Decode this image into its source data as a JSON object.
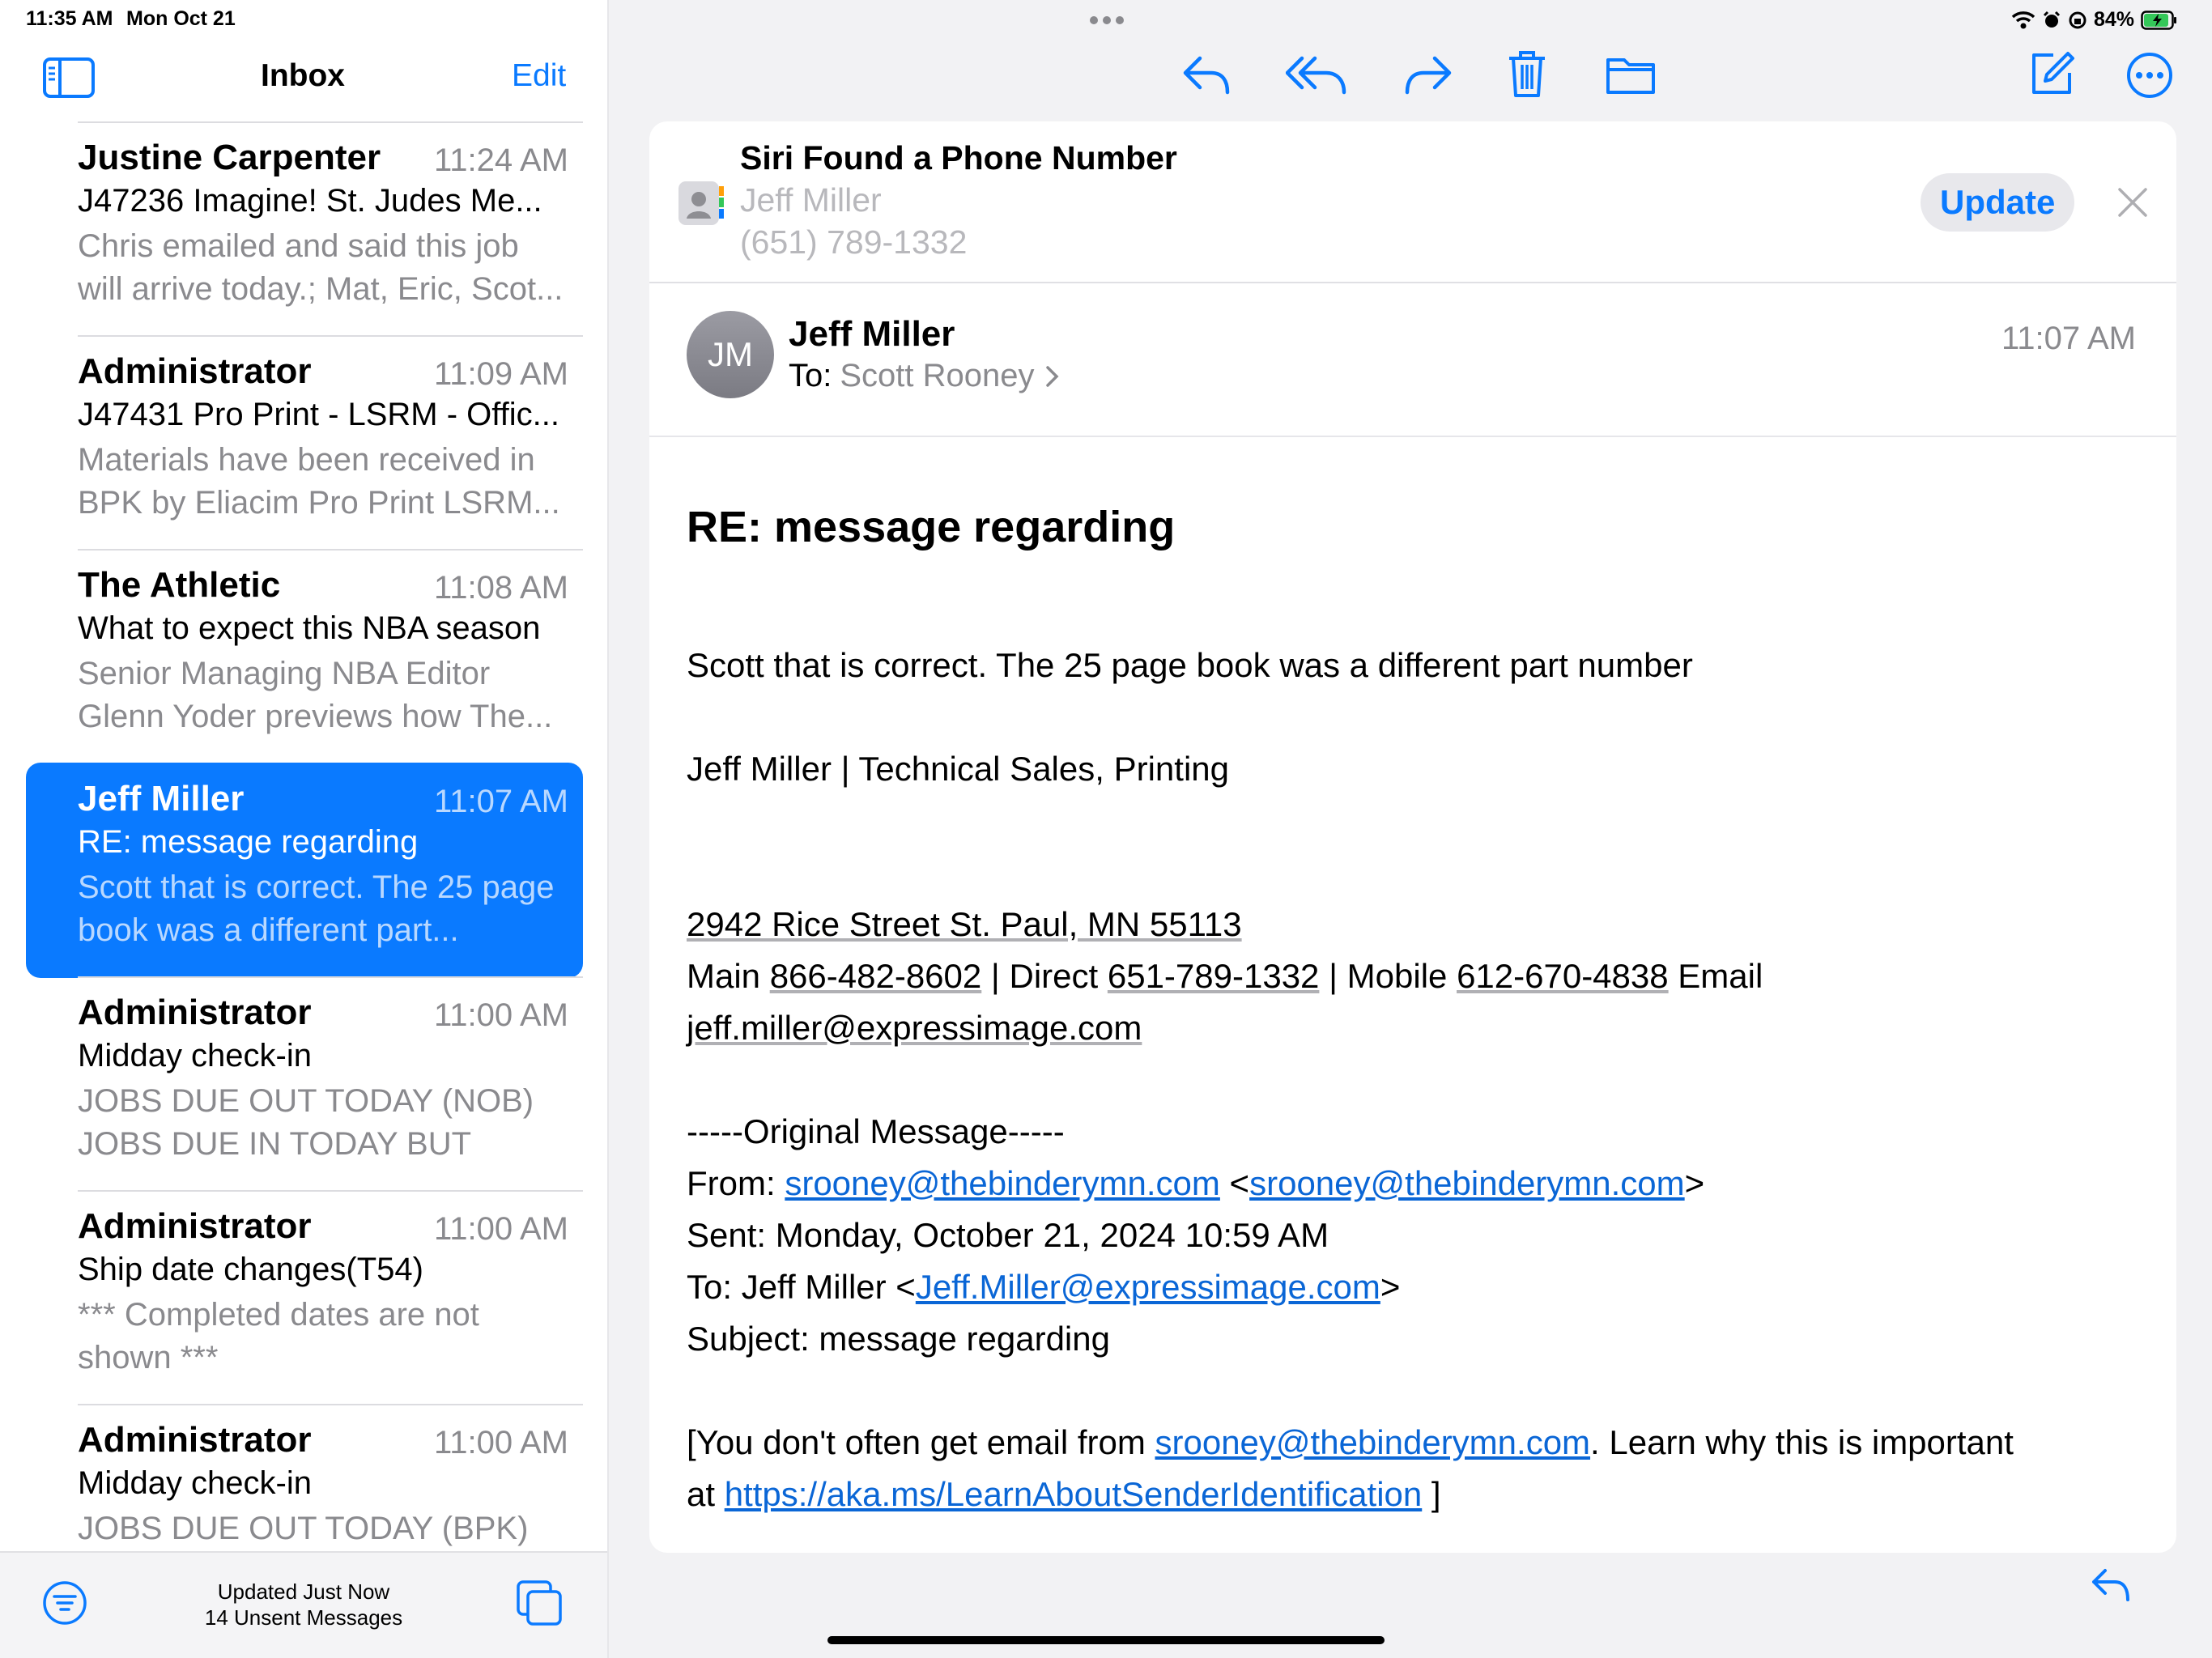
{
  "status": {
    "time": "11:35 AM",
    "date": "Mon Oct 21",
    "battery": "84%"
  },
  "sidebar": {
    "title": "Inbox",
    "edit": "Edit"
  },
  "messages": [
    {
      "sender": "Justine Carpenter",
      "time": "11:24 AM",
      "subject": "J47236 Imagine! St. Judes Me...",
      "preview": "Chris emailed and said this job will arrive today.; Mat, Eric, Scot..."
    },
    {
      "sender": "Administrator",
      "time": "11:09 AM",
      "subject": "J47431 Pro Print - LSRM - Offic...",
      "preview": "Materials have been received in BPK by Eliacim Pro Print LSRM..."
    },
    {
      "sender": "The Athletic",
      "time": "11:08 AM",
      "subject": "What to expect this NBA season",
      "preview": "Senior Managing NBA Editor Glenn Yoder previews how The..."
    },
    {
      "sender": "Jeff Miller",
      "time": "11:07 AM",
      "subject": "RE: message regarding",
      "preview": "Scott that is correct. The 25 page book was a different part...",
      "selected": true
    },
    {
      "sender": "Administrator",
      "time": "11:00 AM",
      "subject": "Midday check-in",
      "preview": "JOBS DUE OUT TODAY (NOB) JOBS DUE IN TODAY BUT NOT..."
    },
    {
      "sender": "Administrator",
      "time": "11:00 AM",
      "subject": "Ship date changes(T54)",
      "preview": "*** Completed dates are not shown ***"
    },
    {
      "sender": "Administrator",
      "time": "11:00 AM",
      "subject": "Midday check-in",
      "preview": "JOBS DUE OUT TODAY (BPK)"
    }
  ],
  "footer": {
    "line1": "Updated Just Now",
    "line2": "14 Unsent Messages"
  },
  "siri": {
    "title": "Siri Found a Phone Number",
    "name": "Jeff Miller",
    "phone": "(651) 789-1332",
    "update": "Update"
  },
  "email": {
    "initials": "JM",
    "from": "Jeff Miller",
    "to_label": "To:",
    "to": "Scott Rooney",
    "time": "11:07 AM",
    "subject": "RE: message regarding",
    "body_line1": "Scott that is correct. The 25 page book was a different part number",
    "signature": "Jeff Miller | Technical Sales, Printing",
    "address": "2942 Rice Street St. Paul, MN 55113",
    "main_label": "Main ",
    "main": "866-482-8602",
    "direct_label": " | Direct ",
    "direct": "651-789-1332",
    "mobile_label": " | Mobile ",
    "mobile": "612-670-4838",
    "email_label": " Email",
    "email": "jeff.miller@expressimage.com",
    "original_header": "-----Original Message-----",
    "orig_from_label": "From: ",
    "orig_from": "srooney@thebinderymn.com",
    "orig_from_lt": " <",
    "orig_from2": "srooney@thebinderymn.com",
    "orig_from_gt": ">",
    "orig_sent": "Sent: Monday, October 21, 2024 10:59 AM",
    "orig_to_label": "To: Jeff Miller <",
    "orig_to_email": "Jeff.Miller@expressimage.com",
    "orig_to_gt": ">",
    "orig_subject": "Subject: message regarding",
    "warn_part1": "[You don't often get email from ",
    "warn_link1": "srooney@thebinderymn.com",
    "warn_part2": ". Learn why this is important",
    "warn_at": "at ",
    "warn_link2": "https://aka.ms/LearnAboutSenderIdentification",
    "warn_end": " ]"
  },
  "colors": {
    "accent": "#0a7aff",
    "selected_bg": "#0a7aff",
    "gray_text": "#8a8a8e"
  }
}
